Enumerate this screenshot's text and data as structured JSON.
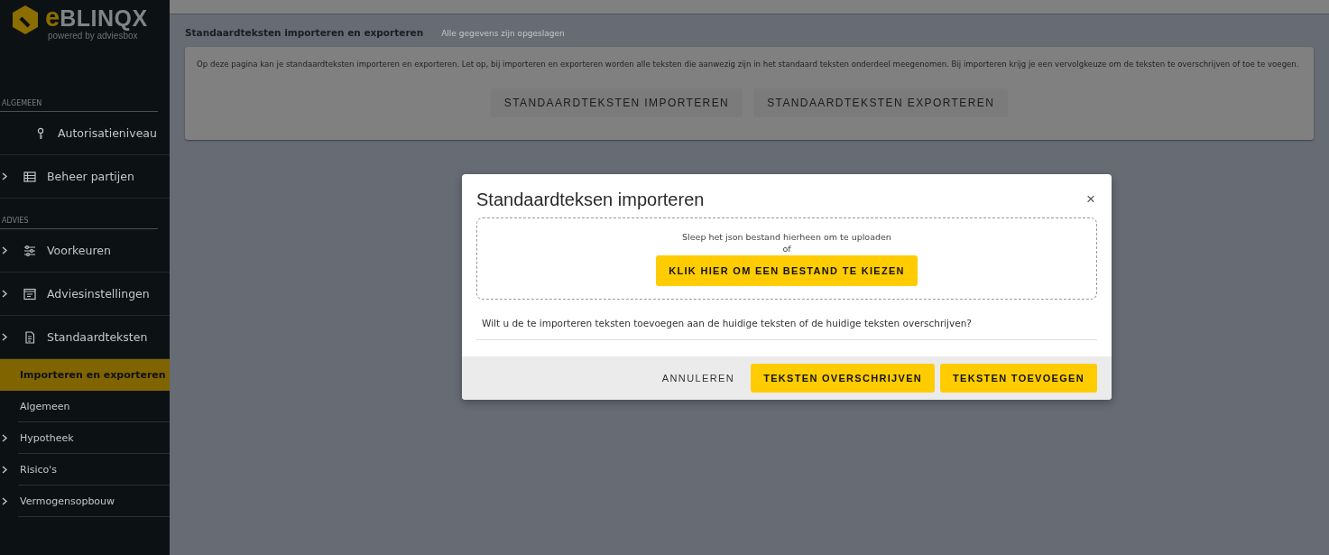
{
  "logo": {
    "brand": "BLINQX",
    "brand_initial": "e",
    "tagline": "powered by adviesbox"
  },
  "sidebar": {
    "sections": [
      {
        "heading": "ALGEMEEN",
        "items": [
          {
            "label": "Autorisatieniveau",
            "chevron": false
          },
          {
            "label": "Beheer partijen",
            "chevron": true
          }
        ]
      },
      {
        "heading": "ADVIES",
        "items": [
          {
            "label": "Voorkeuren",
            "chevron": true
          },
          {
            "label": "Adviesinstellingen",
            "chevron": true
          },
          {
            "label": "Standaardteksten",
            "chevron": true,
            "children": [
              {
                "label": "Importeren en exporteren",
                "selected": true,
                "chevron": false
              },
              {
                "label": "Algemeen",
                "selected": false,
                "chevron": false
              },
              {
                "label": "Hypotheek",
                "selected": false,
                "chevron": true
              },
              {
                "label": "Risico's",
                "selected": false,
                "chevron": true
              },
              {
                "label": "Vermogensopbouw",
                "selected": false,
                "chevron": true
              }
            ]
          }
        ]
      }
    ]
  },
  "page": {
    "title": "Standaardteksten importeren en exporteren",
    "save_status": "Alle gegevens zijn opgeslagen",
    "description": "Op deze pagina kan je standaardteksten importeren en exporteren. Let op, bij importeren en exporteren worden alle teksten die aanwezig zijn in het standaard teksten onderdeel meegenomen. Bij importeren krijg je een vervolgkeuze om de teksten te overschrijven of toe te voegen.",
    "buttons": [
      "STANDAARDTEKSTEN IMPORTEREN",
      "STANDAARDTEKSTEN EXPORTEREN"
    ]
  },
  "dialog": {
    "title": "Standaardteksen importeren",
    "close": "×",
    "dropzone": {
      "hint": "Sleep het json bestand hierheen om te uploaden",
      "or": "of",
      "button": "KLIK HIER OM EEN BESTAND TE KIEZEN"
    },
    "question": "Wilt u de te importeren teksten toevoegen aan de huidige teksten of de huidige teksten overschrijven?",
    "buttons": [
      {
        "label": "ANNULEREN",
        "kind": "text"
      },
      {
        "label": "TEKSTEN OVERSCHRIJVEN",
        "kind": "primary"
      },
      {
        "label": "TEKSTEN TOEVOEGEN",
        "kind": "primary"
      }
    ]
  }
}
